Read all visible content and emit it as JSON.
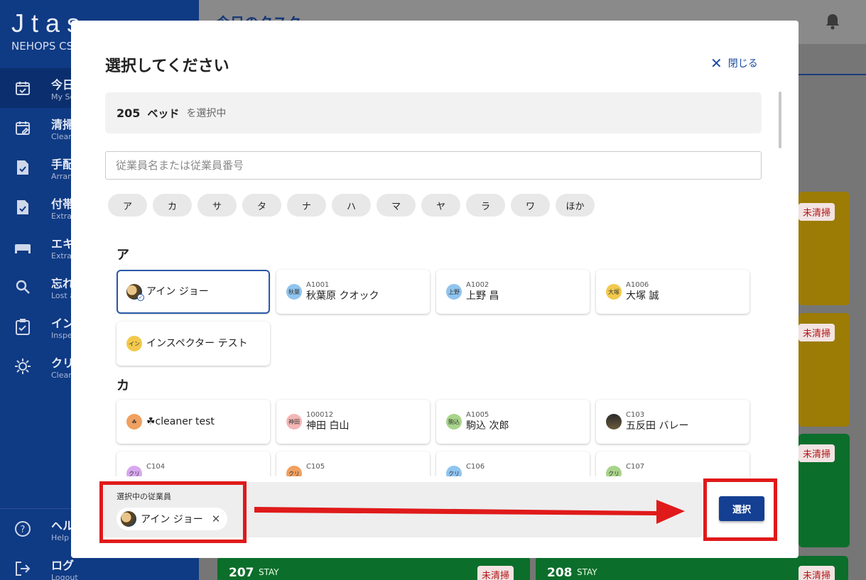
{
  "app": {
    "logo": "Jtas",
    "tenant": "NEHOPS CS",
    "page_title": "今日のタスク",
    "nav": [
      {
        "title": "今日",
        "sub": "My Sc",
        "icon": "calendar-check-icon"
      },
      {
        "title": "清掃",
        "sub": "Clean",
        "icon": "calendar-edit-icon"
      },
      {
        "title": "手配",
        "sub": "Arran",
        "icon": "doc-check-icon"
      },
      {
        "title": "付帯",
        "sub": "Extra",
        "icon": "doc-check-icon"
      },
      {
        "title": "エキ",
        "sub": "Extra",
        "icon": "bed-icon"
      },
      {
        "title": "忘れ",
        "sub": "Lost a",
        "icon": "search-icon"
      },
      {
        "title": "イン",
        "sub": "Inspe",
        "icon": "clipboard-check-icon"
      },
      {
        "title": "クリ",
        "sub": "Clean",
        "icon": "gear-icon"
      }
    ],
    "bottom_nav": [
      {
        "title": "ヘル",
        "sub": "Help",
        "icon": "help-icon"
      },
      {
        "title": "ログ",
        "sub": "Logout",
        "icon": "logout-icon"
      }
    ],
    "bg_status": "未清掃",
    "bg_rooms": [
      {
        "number": "207",
        "type": "STAY"
      },
      {
        "number": "208",
        "type": "STAY"
      }
    ]
  },
  "modal": {
    "title": "選択してください",
    "close_label": "閉じる",
    "selected_room": "205",
    "selected_bed": "ベッド",
    "selected_suffix": "を選択中",
    "search_placeholder": "従業員名または従業員番号",
    "kana_filters": [
      "ア",
      "カ",
      "サ",
      "タ",
      "ナ",
      "ハ",
      "マ",
      "ヤ",
      "ラ",
      "ワ",
      "ほか"
    ],
    "sections": [
      {
        "heading": "ア",
        "employees": [
          {
            "code": "",
            "name": "アイン ジョー",
            "avatar": "",
            "avatar_color": "",
            "selected": true
          },
          {
            "code": "A1001",
            "name": "秋葉原 クオック",
            "avatar": "秋葉",
            "avatar_color": "#8fc4ef"
          },
          {
            "code": "A1002",
            "name": "上野 昌",
            "avatar": "上野",
            "avatar_color": "#8fc4ef"
          },
          {
            "code": "A1006",
            "name": "大塚 誠",
            "avatar": "大塚",
            "avatar_color": "#f2c94c"
          },
          {
            "code": "",
            "name": "インスペクター テスト",
            "avatar": "イン",
            "avatar_color": "#f2c94c"
          }
        ]
      },
      {
        "heading": "カ",
        "employees": [
          {
            "code": "",
            "name": "☘cleaner test",
            "avatar": "☘",
            "avatar_color": "#f0a060"
          },
          {
            "code": "100012",
            "name": "神田 白山",
            "avatar": "神田",
            "avatar_color": "#f4b6b6"
          },
          {
            "code": "A1005",
            "name": "駒込 次郎",
            "avatar": "駒込",
            "avatar_color": "#a8d48a"
          },
          {
            "code": "C103",
            "name": "五反田 バレー",
            "avatar": "",
            "avatar_color": "#3a3a3a"
          },
          {
            "code": "C104",
            "name": "",
            "avatar": "クリ",
            "avatar_color": "#d8a8f0"
          },
          {
            "code": "C105",
            "name": "",
            "avatar": "クリ",
            "avatar_color": "#f0a060"
          },
          {
            "code": "C106",
            "name": "",
            "avatar": "クリ",
            "avatar_color": "#8fc4ef"
          },
          {
            "code": "C107",
            "name": "",
            "avatar": "クリ",
            "avatar_color": "#a8d48a"
          }
        ]
      }
    ],
    "footer_label": "選択中の従業員",
    "chip_name": "アイン ジョー",
    "select_button": "選択"
  },
  "colors": {
    "primary": "#143f93",
    "annotation_red": "#e01a1a",
    "status_red": "#b01717",
    "card_yellow": "#e6b200",
    "card_green": "#12a440"
  }
}
